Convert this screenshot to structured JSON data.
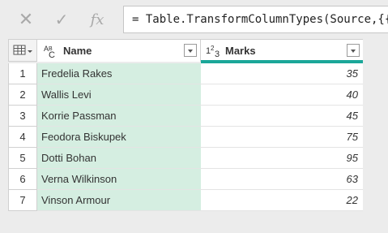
{
  "formula_bar": {
    "close_icon": "✕",
    "check_icon": "✓",
    "fx_label": "fx",
    "formula": "= Table.TransformColumnTypes(Source,{{"
  },
  "grid": {
    "corner_icon": "table-menu-icon",
    "columns": [
      {
        "type_icon": "ABC",
        "title": "Name"
      },
      {
        "type_icon": "123",
        "title": "Marks"
      }
    ],
    "rows": [
      {
        "num": "1",
        "name": "Fredelia Rakes",
        "marks": "35"
      },
      {
        "num": "2",
        "name": "Wallis Levi",
        "marks": "40"
      },
      {
        "num": "3",
        "name": "Korrie Passman",
        "marks": "45"
      },
      {
        "num": "4",
        "name": "Feodora Biskupek",
        "marks": "75"
      },
      {
        "num": "5",
        "name": "Dotti Bohan",
        "marks": "95"
      },
      {
        "num": "6",
        "name": "Verna Wilkinson",
        "marks": "63"
      },
      {
        "num": "7",
        "name": "Vinson Armour",
        "marks": "22"
      }
    ],
    "colors": {
      "selected_column": "#d5eee1",
      "accent": "#1ba799"
    }
  }
}
